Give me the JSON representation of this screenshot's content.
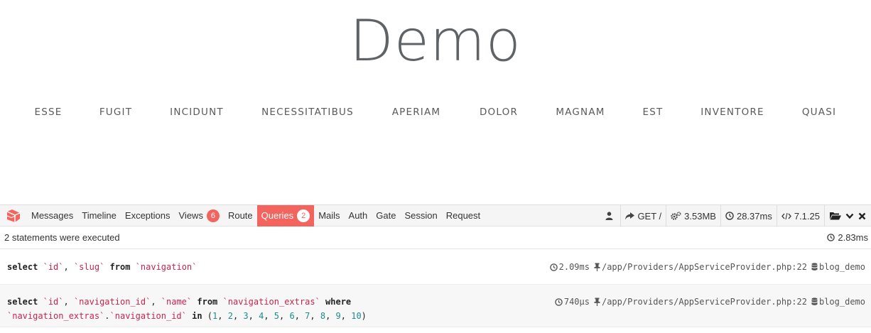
{
  "site": {
    "title": "Demo",
    "nav": [
      "ESSE",
      "FUGIT",
      "INCIDUNT",
      "NECESSITATIBUS",
      "APERIAM",
      "DOLOR",
      "MAGNAM",
      "EST",
      "INVENTORE",
      "QUASI"
    ]
  },
  "debugbar": {
    "accent_color": "#f4645f",
    "tabs": {
      "messages": "Messages",
      "timeline": "Timeline",
      "exceptions": "Exceptions",
      "views": "Views",
      "views_count": "6",
      "route": "Route",
      "queries": "Queries",
      "queries_count": "2",
      "mails": "Mails",
      "auth": "Auth",
      "gate": "Gate",
      "session": "Session",
      "request": "Request"
    },
    "indicators": {
      "method": "GET /",
      "memory": "3.53MB",
      "time": "28.37ms",
      "php": "7.1.25"
    },
    "queries_panel": {
      "status": "2 statements were executed",
      "total_duration": "2.83ms",
      "queries": [
        {
          "duration": "2.09ms",
          "source": "/app/Providers/AppServiceProvider.php:22",
          "connection": "blog_demo"
        },
        {
          "duration": "740μs",
          "source": "/app/Providers/AppServiceProvider.php:22",
          "connection": "blog_demo"
        }
      ]
    }
  }
}
